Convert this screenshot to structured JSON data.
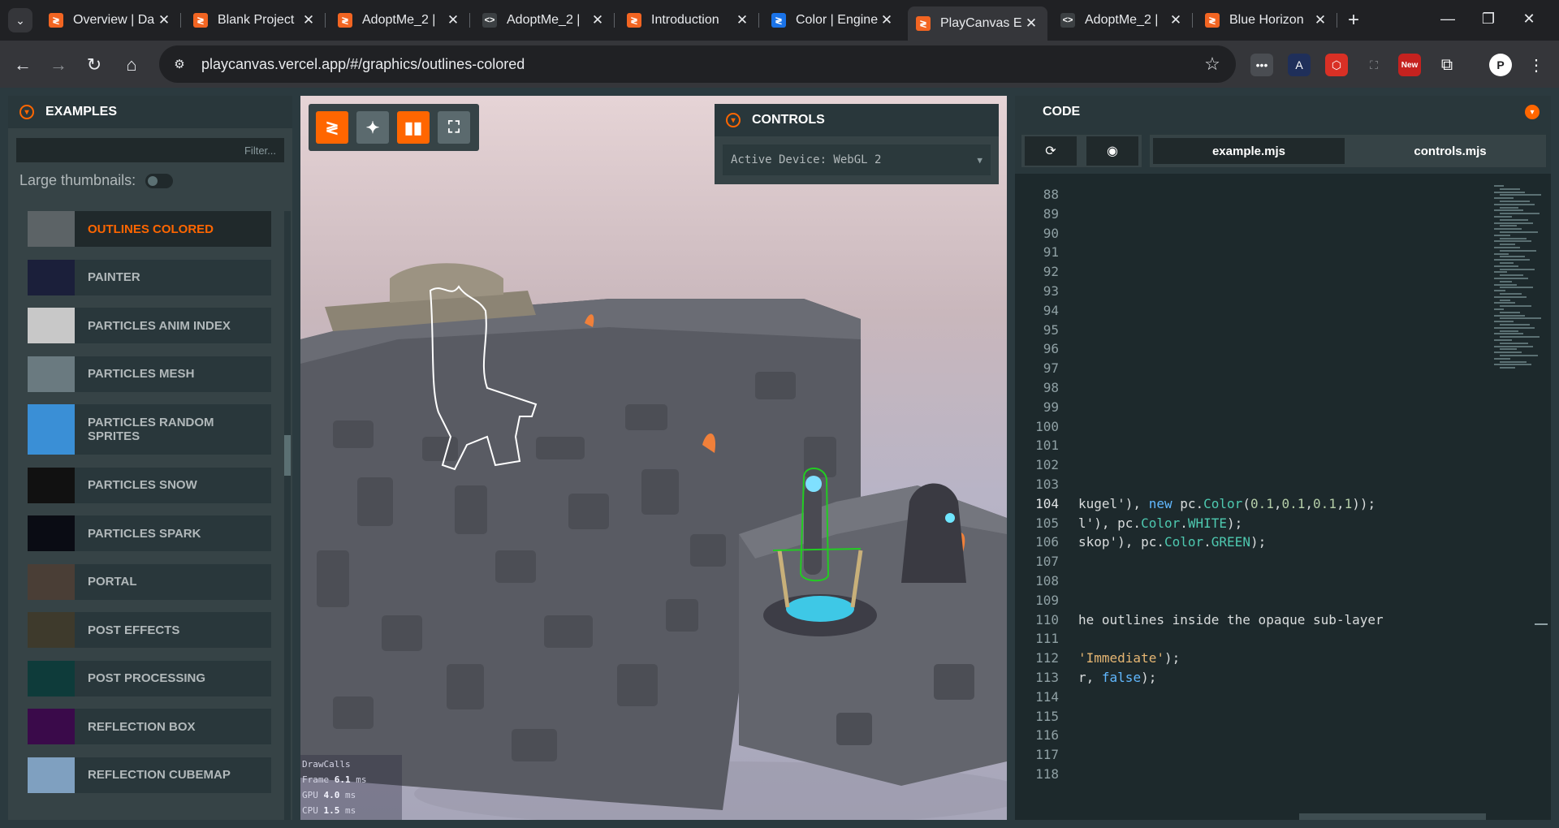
{
  "browser": {
    "tabs": [
      {
        "title": "Overview | Da",
        "fav_color": "#f26522",
        "fav_glyph": "≷"
      },
      {
        "title": "Blank Project",
        "fav_color": "#f26522",
        "fav_glyph": "≷"
      },
      {
        "title": "AdoptMe_2 |",
        "fav_color": "#f26522",
        "fav_glyph": "≷"
      },
      {
        "title": "AdoptMe_2 |",
        "fav_color": "#3c4043",
        "fav_glyph": "<>"
      },
      {
        "title": "Introduction",
        "fav_color": "#f26522",
        "fav_glyph": "≷"
      },
      {
        "title": "Color | Engine",
        "fav_color": "#1a73e8",
        "fav_glyph": "≷"
      },
      {
        "title": "PlayCanvas E",
        "fav_color": "#f26522",
        "fav_glyph": "≷"
      },
      {
        "title": "AdoptMe_2 |",
        "fav_color": "#3c4043",
        "fav_glyph": "<>"
      },
      {
        "title": "Blue Horizon",
        "fav_color": "#f26522",
        "fav_glyph": "≷"
      }
    ],
    "active_tab": 6,
    "url": "playcanvas.vercel.app/#/graphics/outlines-colored",
    "new_badge": "New",
    "profile_initial": "P"
  },
  "examples": {
    "header": "EXAMPLES",
    "filter_placeholder": "Filter...",
    "large_thumbnails_label": "Large thumbnails:",
    "items": [
      {
        "label": "OUTLINES COLORED",
        "selected": true,
        "thumb": "#5c6366"
      },
      {
        "label": "PAINTER",
        "thumb": "#1b1f3a"
      },
      {
        "label": "PARTICLES ANIM INDEX",
        "thumb": "#c8c8c8"
      },
      {
        "label": "PARTICLES MESH",
        "thumb": "#6a7a80"
      },
      {
        "label": "PARTICLES RANDOM SPRITES",
        "thumb": "#3a8fd6"
      },
      {
        "label": "PARTICLES SNOW",
        "thumb": "#111111"
      },
      {
        "label": "PARTICLES SPARK",
        "thumb": "#0a0c14"
      },
      {
        "label": "PORTAL",
        "thumb": "#4a3e36"
      },
      {
        "label": "POST EFFECTS",
        "thumb": "#3e3a2c"
      },
      {
        "label": "POST PROCESSING",
        "thumb": "#0e3b3a"
      },
      {
        "label": "REFLECTION BOX",
        "thumb": "#3a0a4a"
      },
      {
        "label": "REFLECTION CUBEMAP",
        "thumb": "#7fa0c0"
      }
    ]
  },
  "viewport": {
    "controls_header": "CONTROLS",
    "active_device": "Active Device: WebGL 2",
    "stats": [
      {
        "name": "DrawCalls",
        "value": ""
      },
      {
        "name": "Frame",
        "value": "6.1",
        "unit": "ms"
      },
      {
        "name": "GPU",
        "value": "4.0",
        "unit": "ms"
      },
      {
        "name": "CPU",
        "value": "1.5",
        "unit": "ms"
      }
    ]
  },
  "code": {
    "header": "CODE",
    "tabs": [
      "example.mjs",
      "controls.mjs"
    ],
    "active_tab": 0,
    "lines": [
      {
        "no": "88",
        "segs": []
      },
      {
        "no": "89",
        "segs": []
      },
      {
        "no": "90",
        "segs": []
      },
      {
        "no": "91",
        "segs": []
      },
      {
        "no": "92",
        "segs": []
      },
      {
        "no": "93",
        "segs": []
      },
      {
        "no": "94",
        "segs": []
      },
      {
        "no": "95",
        "segs": []
      },
      {
        "no": "96",
        "segs": []
      },
      {
        "no": "97",
        "segs": []
      },
      {
        "no": "98",
        "segs": []
      },
      {
        "no": "99",
        "segs": []
      },
      {
        "no": "100",
        "segs": []
      },
      {
        "no": "101",
        "segs": []
      },
      {
        "no": "102",
        "segs": []
      },
      {
        "no": "103",
        "segs": []
      },
      {
        "no": "104",
        "current": true,
        "segs": [
          [
            "t",
            "kugel'), "
          ],
          [
            "kw",
            "new "
          ],
          [
            "t",
            "pc."
          ],
          [
            "cls",
            "Color"
          ],
          [
            "t",
            "("
          ],
          [
            "num",
            "0.1"
          ],
          [
            "t",
            ","
          ],
          [
            "num",
            "0.1"
          ],
          [
            "t",
            ","
          ],
          [
            "num",
            "0.1"
          ],
          [
            "t",
            ","
          ],
          [
            "num",
            "1"
          ],
          [
            "t",
            "));"
          ]
        ]
      },
      {
        "no": "105",
        "segs": [
          [
            "t",
            "l'), pc."
          ],
          [
            "cls",
            "Color"
          ],
          [
            "t",
            "."
          ],
          [
            "cls",
            "WHITE"
          ],
          [
            "t",
            ");"
          ]
        ]
      },
      {
        "no": "106",
        "segs": [
          [
            "t",
            "skop'), pc."
          ],
          [
            "cls",
            "Color"
          ],
          [
            "t",
            "."
          ],
          [
            "cls",
            "GREEN"
          ],
          [
            "t",
            ");"
          ]
        ]
      },
      {
        "no": "107",
        "segs": []
      },
      {
        "no": "108",
        "segs": []
      },
      {
        "no": "109",
        "segs": []
      },
      {
        "no": "110",
        "segs": [
          [
            "t",
            "he outlines inside the opaque sub-layer"
          ]
        ]
      },
      {
        "no": "111",
        "segs": []
      },
      {
        "no": "112",
        "segs": [
          [
            "str",
            "'Immediate'"
          ],
          [
            "t",
            ");"
          ]
        ]
      },
      {
        "no": "113",
        "segs": [
          [
            "t",
            "r, "
          ],
          [
            "kw",
            "false"
          ],
          [
            "t",
            ");"
          ]
        ]
      },
      {
        "no": "114",
        "segs": []
      },
      {
        "no": "115",
        "segs": []
      },
      {
        "no": "116",
        "segs": []
      },
      {
        "no": "117",
        "segs": []
      },
      {
        "no": "118",
        "segs": []
      }
    ]
  },
  "colors": {
    "accent": "#ff6600",
    "outline_white": "#ffffff",
    "outline_green": "#22cc22"
  }
}
